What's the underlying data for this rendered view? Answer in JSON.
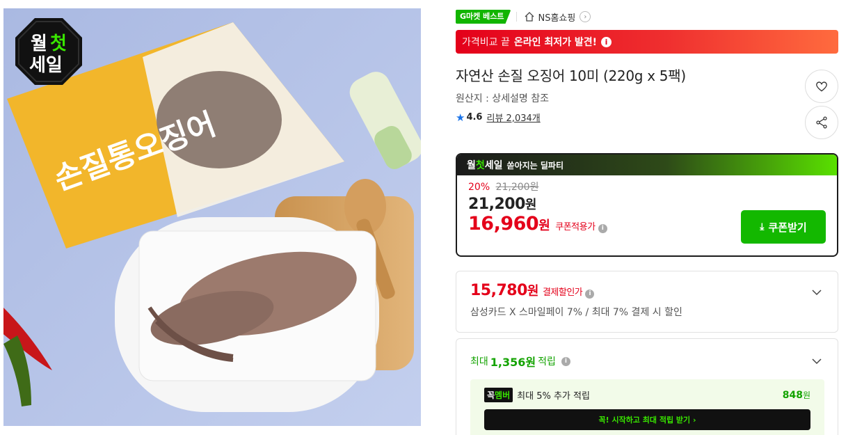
{
  "image": {
    "badge_line1_a": "월",
    "badge_line1_b": "첫",
    "badge_line2": "세일",
    "package_text": "손질통오징어"
  },
  "header": {
    "gmarket_best": "G마켓 베스트",
    "shop_name": "NS홈쇼핑"
  },
  "promo": {
    "lead": "가격비교 끝",
    "strong": "온라인 최저가 발견!"
  },
  "product": {
    "title": "자연산 손질 오징어 10미 (220g x 5팩)",
    "origin": "원산지 : 상세설명 참조",
    "rating": "4.6",
    "review_label": "리뷰 2,034개"
  },
  "deal": {
    "logo_a": "월",
    "logo_b": "첫",
    "logo_c": "세일",
    "tagline": "쏟아지는 딜파티",
    "discount_pct": "20%",
    "original_price": "21,200원",
    "sale_price": "21,200",
    "final_price": "16,960",
    "unit": "원",
    "coupon_note": "쿠폰적용가",
    "coupon_button": "쿠폰받기"
  },
  "card": {
    "price": "15,780",
    "unit": "원",
    "note": "결제할인가",
    "desc": "삼성카드 X 스마일페이 7% / 최대 7% 결제 시 할인"
  },
  "points": {
    "prefix": "최대",
    "amount": "1,356원",
    "suffix": "적립",
    "member_logo_a": "꼭",
    "member_logo_b": "멤버",
    "member_text": "최대 5% 추가 적립",
    "member_value": "848",
    "member_unit": "원",
    "member_button": "꼭! 시작하고 최대 적립 받기  ›"
  },
  "colors": {
    "accent_red": "#e4001a",
    "accent_green": "#13b800"
  }
}
